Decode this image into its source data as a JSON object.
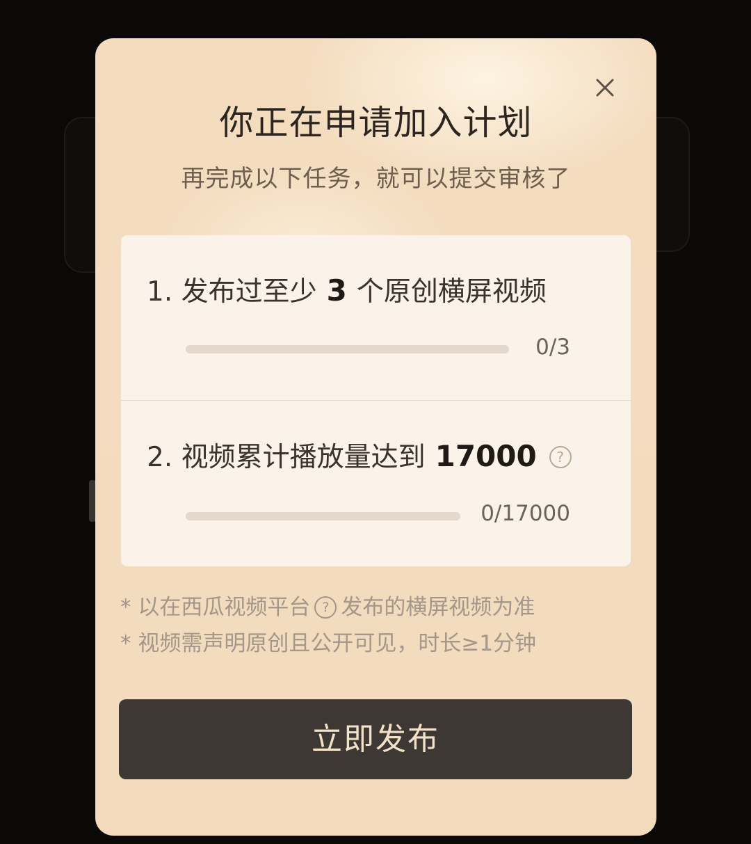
{
  "dialog": {
    "title": "你正在申请加入计划",
    "subtitle": "再完成以下任务，就可以提交审核了",
    "close_icon": "close-icon"
  },
  "tasks": [
    {
      "prefix": "1. 发布过至少",
      "highlight": "3",
      "suffix": "个原创横屏视频",
      "progress_text": "0/3",
      "progress_value": 0,
      "progress_target": 3,
      "has_help_icon": false
    },
    {
      "prefix": "2. 视频累计播放量达到",
      "highlight": "17000",
      "suffix": "",
      "progress_text": "0/17000",
      "progress_value": 0,
      "progress_target": 17000,
      "has_help_icon": true,
      "help_icon": "question-circle-icon",
      "help_glyph": "?"
    }
  ],
  "notes": {
    "line1_before": "* 以在西瓜视频平台",
    "line1_help_glyph": "?",
    "line1_after": "发布的横屏视频为准",
    "line2": "* 视频需声明原创且公开可见，时长≥1分钟"
  },
  "cta": {
    "label": "立即发布"
  },
  "colors": {
    "modal_background": "#f3dcbf",
    "card_background": "#fbf3ea",
    "button_background": "#3d3834",
    "button_text": "#f4e2c8",
    "progress_track": "#e3d8cc"
  }
}
